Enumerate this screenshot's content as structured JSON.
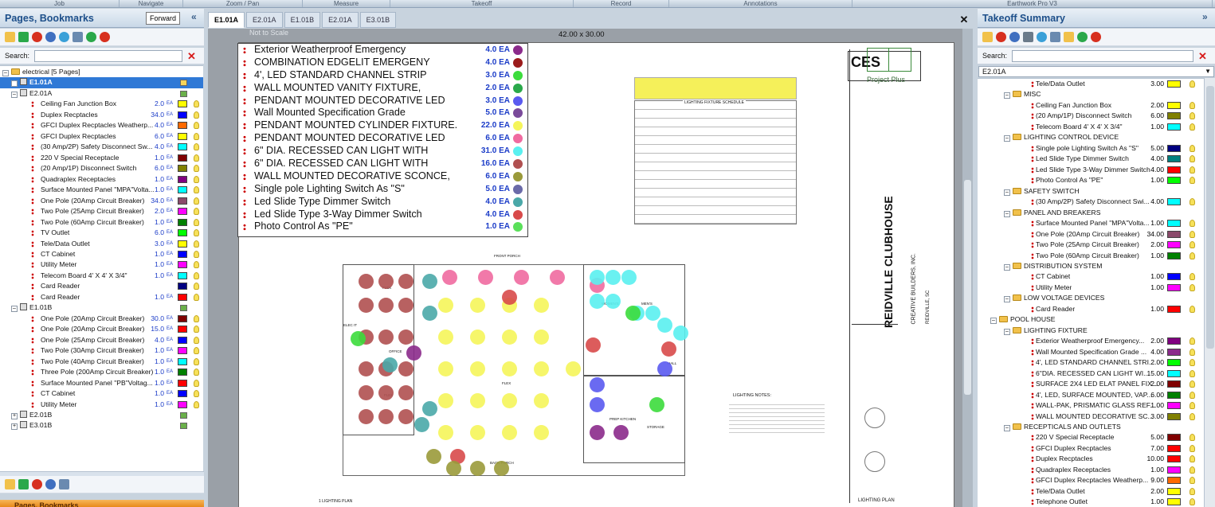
{
  "menu": [
    "Job",
    "Navigate",
    "Zoom / Pan",
    "Measure",
    "Takeoff",
    "Record",
    "Annotations",
    "Earthwork Pro V3"
  ],
  "left_panel": {
    "title": "Pages, Bookmarks",
    "tooltip": "Forward",
    "search_label": "Search:",
    "bottom_title": "Pages, Bookmarks",
    "root": "electrical [5 Pages]",
    "pages": [
      {
        "label": "E1.01A",
        "selected": true,
        "items": []
      },
      {
        "label": "E2.01A",
        "items": [
          {
            "name": "Ceiling Fan Junction Box",
            "qty": "2.0",
            "color": "#ffff00"
          },
          {
            "name": "Duplex Recptacles",
            "qty": "34.0",
            "color": "#0000ff"
          },
          {
            "name": "GFCI Duplex Recptacles Weatherp...",
            "qty": "4.0",
            "color": "#ff6a00"
          },
          {
            "name": "GFCI Duplex Recptacles",
            "qty": "6.0",
            "color": "#ffff00"
          },
          {
            "name": "(30 Amp/2P) Safety Disconnect Sw...",
            "qty": "4.0",
            "color": "#00ffff"
          },
          {
            "name": "220 V Special Receptacle",
            "qty": "1.0",
            "color": "#800000"
          },
          {
            "name": "(20 Amp/1P) Disconnect Switch",
            "qty": "6.0",
            "color": "#808000"
          },
          {
            "name": "Quadraplex Receptacles",
            "qty": "1.0",
            "color": "#800080"
          },
          {
            "name": "Surface Mounted Panel \"MPA\"Volta...",
            "qty": "1.0",
            "color": "#00ffff"
          },
          {
            "name": "One Pole (20Amp Circuit Breaker)",
            "qty": "34.0",
            "color": "#8b4a6b"
          },
          {
            "name": "Two Pole (25Amp Circuit Breaker)",
            "qty": "2.0",
            "color": "#ff00ff"
          },
          {
            "name": "Two Pole (60Amp Circuit Breaker)",
            "qty": "1.0",
            "color": "#008000"
          },
          {
            "name": "TV Outlet",
            "qty": "6.0",
            "color": "#00ff00"
          },
          {
            "name": "Tele/Data Outlet",
            "qty": "3.0",
            "color": "#ffff00"
          },
          {
            "name": "CT Cabinet",
            "qty": "1.0",
            "color": "#0000ff"
          },
          {
            "name": "Utility Meter",
            "qty": "1.0",
            "color": "#ff00ff"
          },
          {
            "name": "Telecom Board 4' X 4' X 3/4\"",
            "qty": "1.0",
            "color": "#00ffff"
          },
          {
            "name": "Card Reader",
            "qty": "",
            "color": "#000080"
          },
          {
            "name": "Card Reader",
            "qty": "1.0",
            "color": "#ff0000"
          }
        ]
      },
      {
        "label": "E1.01B",
        "items": [
          {
            "name": "One Pole (20Amp Circuit Breaker)",
            "qty": "30.0",
            "color": "#800000"
          },
          {
            "name": "One Pole (20Amp Circuit Breaker)",
            "qty": "15.0",
            "color": "#ff0000"
          },
          {
            "name": "One Pole (25Amp Circuit Breaker)",
            "qty": "4.0",
            "color": "#0000ff"
          },
          {
            "name": "Two Pole (30Amp Circuit Breaker)",
            "qty": "1.0",
            "color": "#ff00ff"
          },
          {
            "name": "Two Pole (40Amp Circuit Breaker)",
            "qty": "1.0",
            "color": "#00ffff"
          },
          {
            "name": "Three Pole (200Amp Circuit Breaker)",
            "qty": "1.0",
            "color": "#008000"
          },
          {
            "name": "Surface Mounted Panel \"PB\"Voltag...",
            "qty": "1.0",
            "color": "#ff0000"
          },
          {
            "name": "CT Cabinet",
            "qty": "1.0",
            "color": "#0000ff"
          },
          {
            "name": "Utility Meter",
            "qty": "1.0",
            "color": "#ff00ff"
          }
        ]
      },
      {
        "label": "E2.01B",
        "items": []
      },
      {
        "label": "E3.01B",
        "items": []
      }
    ],
    "unit": "EA"
  },
  "tabs": [
    "E1.01A",
    "E2.01A",
    "E1.01B",
    "E2.01A",
    "E3.01B"
  ],
  "viewer": {
    "scale_note": "Not to Scale",
    "size": "42.00 x 30.00"
  },
  "legend": [
    {
      "name": "Exterior Weatherproof Emergency",
      "qty": "4.0 EA",
      "color": "#8b2a8b"
    },
    {
      "name": "COMBINATION EDGELIT EMERGENY",
      "qty": "4.0 EA",
      "color": "#9b1b1b"
    },
    {
      "name": "4', LED STANDARD CHANNEL STRIP",
      "qty": "3.0 EA",
      "color": "#3cdc3c"
    },
    {
      "name": "WALL MOUNTED VANITY FIXTURE,",
      "qty": "2.0 EA",
      "color": "#2aa94a"
    },
    {
      "name": "PENDANT MOUNTED DECORATIVE LED",
      "qty": "3.0 EA",
      "color": "#5a5af0"
    },
    {
      "name": "Wall Mounted Specification Grade",
      "qty": "5.0 EA",
      "color": "#7a4a9a"
    },
    {
      "name": "PENDANT MOUNTED CYLINDER FIXTURE.",
      "qty": "22.0 EA",
      "color": "#f5f55a"
    },
    {
      "name": "PENDANT MOUNTED DECORATIVE LED",
      "qty": "6.0 EA",
      "color": "#f06aa0"
    },
    {
      "name": "6\" DIA. RECESSED CAN LIGHT WITH",
      "qty": "31.0 EA",
      "color": "#5af0f0"
    },
    {
      "name": "6\" DIA. RECESSED CAN LIGHT WITH",
      "qty": "16.0 EA",
      "color": "#b05050"
    },
    {
      "name": "WALL MOUNTED DECORATIVE SCONCE,",
      "qty": "6.0 EA",
      "color": "#9a9a3a"
    },
    {
      "name": "Single pole Lighting Switch As  \"S\"",
      "qty": "5.0 EA",
      "color": "#6a6aa8"
    },
    {
      "name": "Led Slide Type Dimmer Switch",
      "qty": "4.0 EA",
      "color": "#4aa8a8"
    },
    {
      "name": "Led Slide Type 3-Way Dimmer Switch",
      "qty": "4.0 EA",
      "color": "#d84a4a"
    },
    {
      "name": "Photo Control As \"PE\"",
      "qty": "1.0 EA",
      "color": "#5ae05a"
    }
  ],
  "drawing": {
    "firm": "CES",
    "project_plus": "Project Plus",
    "title": "REIDVILLE CLUBHOUSE",
    "builder": "CREATIVE BUILDERS, INC.",
    "location": "REIDVILLE, SC",
    "sheet": "LIGHTING PLAN",
    "schedule": "LIGHTING FIXTURE SCHEDULE",
    "notes": "LIGHTING NOTES:",
    "plan_label": "1 LIGHTING PLAN",
    "rooms": [
      "FRONT PORCH",
      "FLEX",
      "OFFICE",
      "ELEC IT",
      "FLEX",
      "WOMEN'S",
      "MEN'S",
      "HALL",
      "PREP KITCHEN",
      "STORAGE",
      "BACK PORCH",
      "FLEX"
    ]
  },
  "right_panel": {
    "title": "Takeoff Summary",
    "search_label": "Search:",
    "dropdown": "E2.01A",
    "rows": [
      {
        "lvl": 3,
        "type": "item",
        "name": "Tele/Data Outlet",
        "qty": "3.00",
        "color": "#ffff00"
      },
      {
        "lvl": 2,
        "type": "group",
        "name": "MISC"
      },
      {
        "lvl": 3,
        "type": "item",
        "name": "Ceiling Fan Junction Box",
        "qty": "2.00",
        "color": "#ffff00"
      },
      {
        "lvl": 3,
        "type": "item",
        "name": "(20 Amp/1P) Disconnect Switch",
        "qty": "6.00",
        "color": "#808000"
      },
      {
        "lvl": 3,
        "type": "item",
        "name": "Telecom Board 4' X 4' X 3/4\"",
        "qty": "1.00",
        "color": "#00ffff"
      },
      {
        "lvl": 2,
        "type": "group",
        "name": "LIGHTING CONTROL DEVICE"
      },
      {
        "lvl": 3,
        "type": "item",
        "name": "Single pole Lighting Switch As  \"S\"",
        "qty": "5.00",
        "color": "#000080"
      },
      {
        "lvl": 3,
        "type": "item",
        "name": "Led Slide Type Dimmer Switch",
        "qty": "4.00",
        "color": "#008080"
      },
      {
        "lvl": 3,
        "type": "item",
        "name": "Led Slide Type 3-Way Dimmer Switch",
        "qty": "4.00",
        "color": "#ff0000"
      },
      {
        "lvl": 3,
        "type": "item",
        "name": "Photo Control As \"PE\"",
        "qty": "1.00",
        "color": "#00ff00"
      },
      {
        "lvl": 2,
        "type": "group",
        "name": "SAFETY SWITCH"
      },
      {
        "lvl": 3,
        "type": "item",
        "name": "(30 Amp/2P) Safety Disconnect Swi...",
        "qty": "4.00",
        "color": "#00ffff"
      },
      {
        "lvl": 2,
        "type": "group",
        "name": "PANEL AND BREAKERS"
      },
      {
        "lvl": 3,
        "type": "item",
        "name": "Surface Mounted Panel \"MPA\"Volta...",
        "qty": "1.00",
        "color": "#00ffff"
      },
      {
        "lvl": 3,
        "type": "item",
        "name": "One Pole (20Amp Circuit Breaker)",
        "qty": "34.00",
        "color": "#8b4a6b"
      },
      {
        "lvl": 3,
        "type": "item",
        "name": "Two Pole (25Amp Circuit Breaker)",
        "qty": "2.00",
        "color": "#ff00ff"
      },
      {
        "lvl": 3,
        "type": "item",
        "name": "Two Pole (60Amp Circuit Breaker)",
        "qty": "1.00",
        "color": "#008000"
      },
      {
        "lvl": 2,
        "type": "group",
        "name": "DISTRIBUTION SYSTEM"
      },
      {
        "lvl": 3,
        "type": "item",
        "name": "CT Cabinet",
        "qty": "1.00",
        "color": "#0000ff"
      },
      {
        "lvl": 3,
        "type": "item",
        "name": "Utility Meter",
        "qty": "1.00",
        "color": "#ff00ff"
      },
      {
        "lvl": 2,
        "type": "group",
        "name": "LOW VOLTAGE DEVICES"
      },
      {
        "lvl": 3,
        "type": "item",
        "name": "Card Reader",
        "qty": "1.00",
        "color": "#ff0000"
      },
      {
        "lvl": 1,
        "type": "group",
        "name": "POOL HOUSE"
      },
      {
        "lvl": 2,
        "type": "group",
        "name": "LIGHTING FIXTURE"
      },
      {
        "lvl": 3,
        "type": "item",
        "name": "Exterior Weatherproof Emergency...",
        "qty": "2.00",
        "color": "#800080"
      },
      {
        "lvl": 3,
        "type": "item",
        "name": "Wall Mounted Specification Grade ...",
        "qty": "4.00",
        "color": "#8b2a8b"
      },
      {
        "lvl": 3,
        "type": "item",
        "name": "4', LED STANDARD CHANNEL STRI...",
        "qty": "2.00",
        "color": "#00ff00"
      },
      {
        "lvl": 3,
        "type": "item",
        "name": "6\"DIA. RECESSED CAN LIGHT WI...",
        "qty": "15.00",
        "color": "#00ffff"
      },
      {
        "lvl": 3,
        "type": "item",
        "name": "SURFACE 2X4 LED ELAT PANEL FIX...",
        "qty": "2.00",
        "color": "#800000"
      },
      {
        "lvl": 3,
        "type": "item",
        "name": "4', LED, SURFACE MOUNTED, VAP...",
        "qty": "6.00",
        "color": "#008000"
      },
      {
        "lvl": 3,
        "type": "item",
        "name": "WALL-PAK, PRISMATIC GLASS REF...",
        "qty": "1.00",
        "color": "#ff00ff"
      },
      {
        "lvl": 3,
        "type": "item",
        "name": "WALL MOUNTED DECORATIVE SC...",
        "qty": "3.00",
        "color": "#808000"
      },
      {
        "lvl": 2,
        "type": "group",
        "name": "RECEPTICALS AND OUTLETS"
      },
      {
        "lvl": 3,
        "type": "item",
        "name": "220 V Special Receptacle",
        "qty": "5.00",
        "color": "#800000"
      },
      {
        "lvl": 3,
        "type": "item",
        "name": "GFCI Duplex Recptacles",
        "qty": "7.00",
        "color": "#ff0000"
      },
      {
        "lvl": 3,
        "type": "item",
        "name": "Duplex Recptacles",
        "qty": "10.00",
        "color": "#ff0000"
      },
      {
        "lvl": 3,
        "type": "item",
        "name": "Quadraplex Receptacles",
        "qty": "1.00",
        "color": "#ff00ff"
      },
      {
        "lvl": 3,
        "type": "item",
        "name": "GFCI Duplex Recptacles Weatherp...",
        "qty": "9.00",
        "color": "#ff6a00"
      },
      {
        "lvl": 3,
        "type": "item",
        "name": "Tele/Data Outlet",
        "qty": "2.00",
        "color": "#ffff00"
      },
      {
        "lvl": 3,
        "type": "item",
        "name": "Telephone Outlet",
        "qty": "1.00",
        "color": "#ffff00"
      }
    ]
  }
}
